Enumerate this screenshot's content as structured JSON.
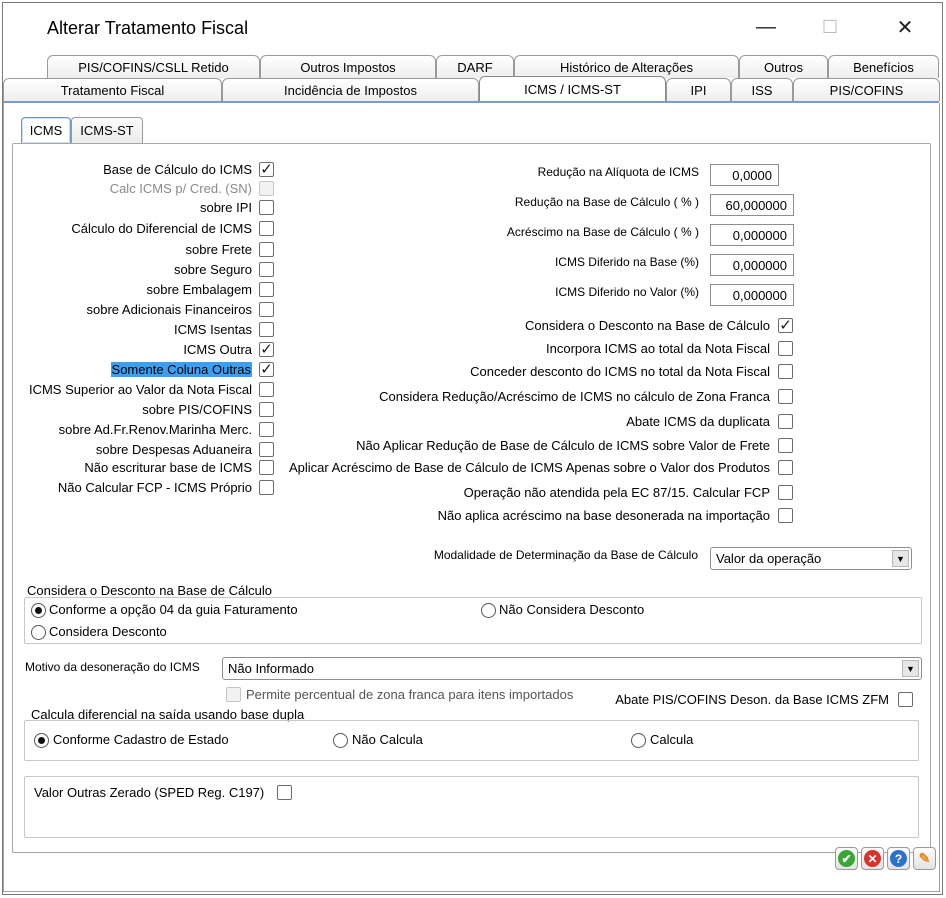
{
  "window": {
    "title": "Alterar Tratamento Fiscal",
    "minimize_glyph": "—",
    "maximize_glyph": "☐",
    "close_glyph": "✕"
  },
  "tabs_row1": [
    "PIS/COFINS/CSLL Retido",
    "Outros Impostos",
    "DARF",
    "Histórico de Alterações",
    "Outros",
    "Benefícios"
  ],
  "tabs_row2": [
    "Tratamento Fiscal",
    "Incidência de Impostos",
    "ICMS / ICMS-ST",
    "IPI",
    "ISS",
    "PIS/COFINS"
  ],
  "active_tab": "ICMS / ICMS-ST",
  "subtabs": [
    "ICMS",
    "ICMS-ST"
  ],
  "active_subtab": "ICMS",
  "left_checks": [
    {
      "label": "Base de Cálculo do ICMS",
      "checked": true
    },
    {
      "label": "Calc ICMS p/ Cred. (SN)",
      "checked": false,
      "disabled": true
    },
    {
      "label": "sobre IPI",
      "checked": false
    },
    {
      "label": "Cálculo do Diferencial de ICMS",
      "checked": false
    },
    {
      "label": "sobre Frete",
      "checked": false
    },
    {
      "label": "sobre Seguro",
      "checked": false
    },
    {
      "label": "sobre Embalagem",
      "checked": false
    },
    {
      "label": "sobre Adicionais Financeiros",
      "checked": false
    },
    {
      "label": "ICMS Isentas",
      "checked": false
    },
    {
      "label": "ICMS Outra",
      "checked": true
    },
    {
      "label": "Somente Coluna Outras",
      "checked": true,
      "selected": true
    },
    {
      "label": "ICMS Superior ao Valor da Nota Fiscal",
      "checked": false
    },
    {
      "label": "sobre PIS/COFINS",
      "checked": false
    },
    {
      "label": "sobre Ad.Fr.Renov.Marinha Merc.",
      "checked": false
    },
    {
      "label": "sobre Despesas Aduaneira",
      "checked": false
    },
    {
      "label": "Não escriturar base de ICMS",
      "checked": false
    },
    {
      "label": "Não Calcular FCP - ICMS Próprio",
      "checked": false
    }
  ],
  "right_fields": [
    {
      "label": "Redução na Alíquota de ICMS",
      "value": "0,0000"
    },
    {
      "label": "Redução na Base de Cálculo ( % )",
      "value": "60,000000"
    },
    {
      "label": "Acréscimo na Base de Cálculo ( % )",
      "value": "0,000000"
    },
    {
      "label": "ICMS Diferido na Base (%)",
      "value": "0,000000"
    },
    {
      "label": "ICMS Diferido no Valor (%)",
      "value": "0,000000"
    }
  ],
  "right_checks": [
    {
      "label": "Considera o Desconto na Base de Cálculo",
      "checked": true
    },
    {
      "label": "Incorpora ICMS ao total da Nota Fiscal",
      "checked": false
    },
    {
      "label": "Conceder desconto do ICMS no total da Nota Fiscal",
      "checked": false
    },
    {
      "label": "Considera Redução/Acréscimo de ICMS no cálculo de Zona Franca",
      "checked": false
    },
    {
      "label": "Abate ICMS da duplicata",
      "checked": false
    },
    {
      "label": "Não Aplicar Redução de Base de Cálculo de ICMS sobre Valor de Frete",
      "checked": false
    },
    {
      "label": "Aplicar Acréscimo de Base de Cálculo de ICMS Apenas sobre o Valor dos Produtos",
      "checked": false
    },
    {
      "label": "Operação não atendida pela EC 87/15. Calcular FCP",
      "checked": false
    },
    {
      "label": "Não aplica acréscimo na base desonerada na importação",
      "checked": false
    }
  ],
  "modalidade": {
    "label": "Modalidade de Determinação da Base de Cálculo",
    "value": "Valor da operação"
  },
  "desconto_group": {
    "title": "Considera o Desconto na Base de Cálculo",
    "options": [
      "Conforme a opção 04 da guia Faturamento",
      "Não Considera Desconto",
      "Considera Desconto"
    ],
    "selected": "Conforme a opção 04 da guia Faturamento"
  },
  "motivo": {
    "label": "Motivo da desoneração do ICMS",
    "value": "Não Informado"
  },
  "permite_zona_franca": {
    "label": "Permite percentual de zona franca para itens importados",
    "checked": false,
    "disabled": true
  },
  "abate_pis": {
    "label": "Abate PIS/COFINS Deson. da Base ICMS ZFM",
    "checked": false
  },
  "diferencial_group": {
    "title": "Calcula diferencial na saída usando base dupla",
    "options": [
      "Conforme Cadastro de Estado",
      "Não Calcula",
      "Calcula"
    ],
    "selected": "Conforme Cadastro de Estado"
  },
  "valor_outras": {
    "label": "Valor Outras Zerado (SPED Reg. C197)",
    "checked": false
  },
  "check_glyph": "✓",
  "footer_buttons": [
    {
      "icon": "ok-icon",
      "glyph": "✔",
      "color": "#3aa635"
    },
    {
      "icon": "cancel-icon",
      "glyph": "✕",
      "color": "#d9332b"
    },
    {
      "icon": "help-icon",
      "glyph": "?",
      "color": "#2a72c9"
    },
    {
      "icon": "wrench-icon",
      "glyph": "🔧",
      "color": "#e38a1b"
    }
  ]
}
